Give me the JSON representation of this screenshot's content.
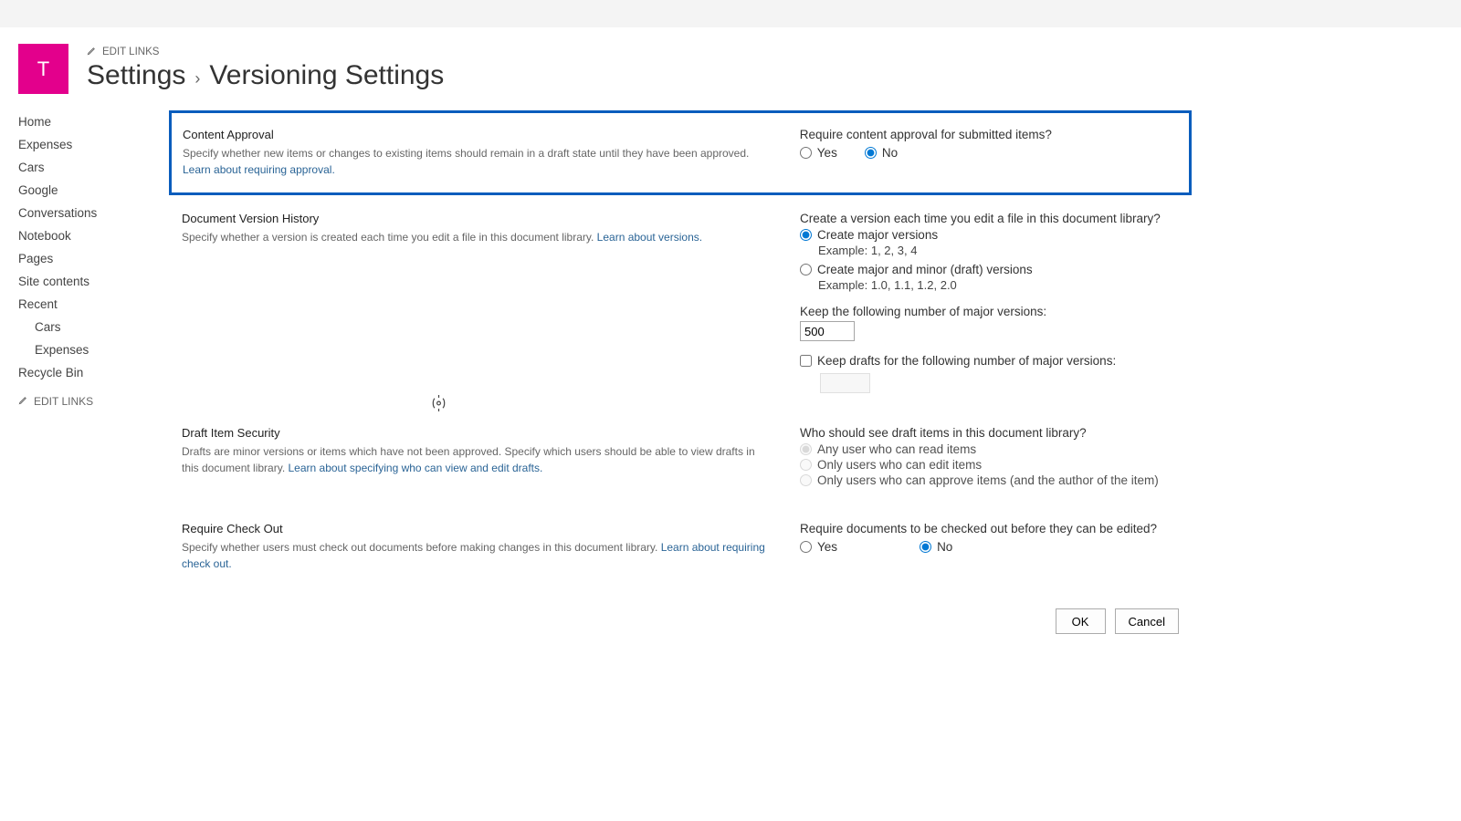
{
  "site_logo_letter": "T",
  "edit_links_label": "EDIT LINKS",
  "breadcrumb": {
    "parent": "Settings",
    "current": "Versioning Settings"
  },
  "sidebar": {
    "items": [
      "Home",
      "Expenses",
      "Cars",
      "Google",
      "Conversations",
      "Notebook",
      "Pages",
      "Site contents",
      "Recent"
    ],
    "recent_children": [
      "Cars",
      "Expenses"
    ],
    "recycle": "Recycle Bin",
    "edit_links": "EDIT LINKS"
  },
  "sections": {
    "content_approval": {
      "title": "Content Approval",
      "desc": "Specify whether new items or changes to existing items should remain in a draft state until they have been approved.  ",
      "link": "Learn about requiring approval.",
      "question": "Require content approval for submitted items?",
      "yes": "Yes",
      "no": "No"
    },
    "version_history": {
      "title": "Document Version History",
      "desc": "Specify whether a version is created each time you edit a file in this document library.  ",
      "link": "Learn about versions.",
      "q1": "Create a version each time you edit a file in this document library?",
      "opt_major": "Create major versions",
      "ex_major": "Example: 1, 2, 3, 4",
      "opt_minor": "Create major and minor (draft) versions",
      "ex_minor": "Example: 1.0, 1.1, 1.2, 2.0",
      "keep_major": "Keep the following number of major versions:",
      "keep_major_value": "500",
      "keep_drafts": "Keep drafts for the following number of major versions:"
    },
    "draft_security": {
      "title": "Draft Item Security",
      "desc": "Drafts are minor versions or items which have not been approved. Specify which users should be able to view drafts in this document library.  ",
      "link": "Learn about specifying who can view and edit drafts.",
      "q": "Who should see draft items in this document library?",
      "opt1": "Any user who can read items",
      "opt2": "Only users who can edit items",
      "opt3": "Only users who can approve items (and the author of the item)"
    },
    "checkout": {
      "title": "Require Check Out",
      "desc": "Specify whether users must check out documents before making changes in this document library.  ",
      "link": "Learn about requiring check out.",
      "q": "Require documents to be checked out before they can be edited?",
      "yes": "Yes",
      "no": "No"
    }
  },
  "buttons": {
    "ok": "OK",
    "cancel": "Cancel"
  }
}
